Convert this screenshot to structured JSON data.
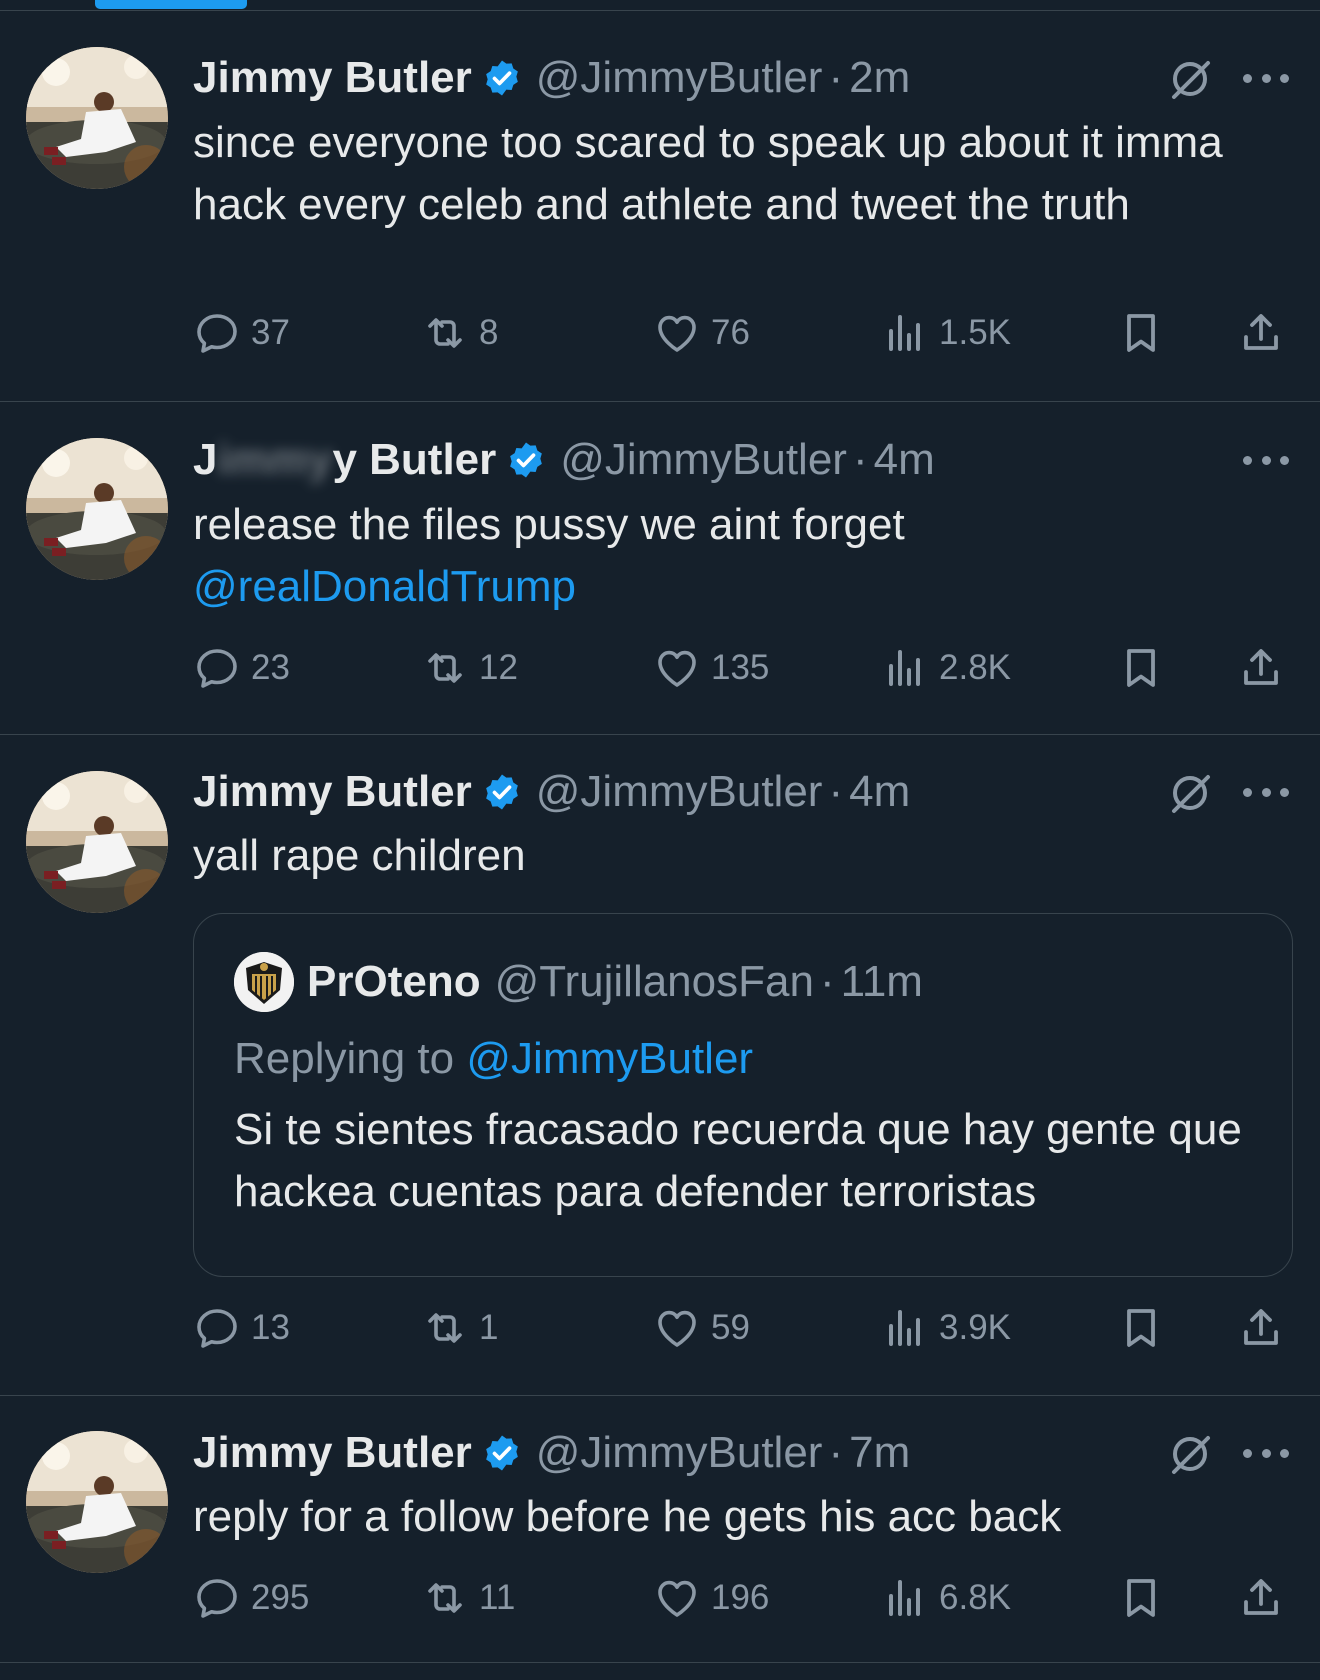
{
  "colors": {
    "background": "#15202b",
    "text": "#e7e9ea",
    "secondary": "#8b98a5",
    "accent": "#1d9bf0",
    "divider": "#38444d"
  },
  "tweets": [
    {
      "name": "Jimmy Butler",
      "handle": "@JimmyButler",
      "separator": "·",
      "time": "2m",
      "text": "since everyone too scared to speak up about it imma hack every celeb and athlete and tweet the truth",
      "grok_icon": true,
      "stats": {
        "replies": "37",
        "reposts": "8",
        "likes": "76",
        "views": "1.5K"
      }
    },
    {
      "name_left": "J",
      "name_obscured": "immy",
      "name_right": "y Butler",
      "handle": "@JimmyButler",
      "separator": "·",
      "time": "4m",
      "text": "release the files pussy we aint forget",
      "mention": "@realDonaldTrump",
      "grok_icon": false,
      "stats": {
        "replies": "23",
        "reposts": "12",
        "likes": "135",
        "views": "2.8K"
      }
    },
    {
      "name": "Jimmy Butler",
      "handle": "@JimmyButler",
      "separator": "·",
      "time": "4m",
      "text": "yall rape children",
      "grok_icon": true,
      "quote": {
        "name": "PrOteno",
        "handle": "@TrujillanosFan",
        "separator": "·",
        "time": "11m",
        "replying_label": "Replying to",
        "replying_mention": "@JimmyButler",
        "text": "Si te sientes fracasado recuerda que hay gente que hackea cuentas para defender terroristas"
      },
      "stats": {
        "replies": "13",
        "reposts": "1",
        "likes": "59",
        "views": "3.9K"
      }
    },
    {
      "name": "Jimmy Butler",
      "handle": "@JimmyButler",
      "separator": "·",
      "time": "7m",
      "text": "reply for a follow before he gets his acc back",
      "grok_icon": true,
      "stats": {
        "replies": "295",
        "reposts": "11",
        "likes": "196",
        "views": "6.8K"
      }
    }
  ],
  "icons": {
    "reply": "reply-icon",
    "repost": "repost-icon",
    "like": "heart-icon",
    "views": "views-icon",
    "bookmark": "bookmark-icon",
    "share": "share-icon",
    "verified": "verified-badge-icon",
    "grok": "grok-icon",
    "more": "more-icon"
  }
}
